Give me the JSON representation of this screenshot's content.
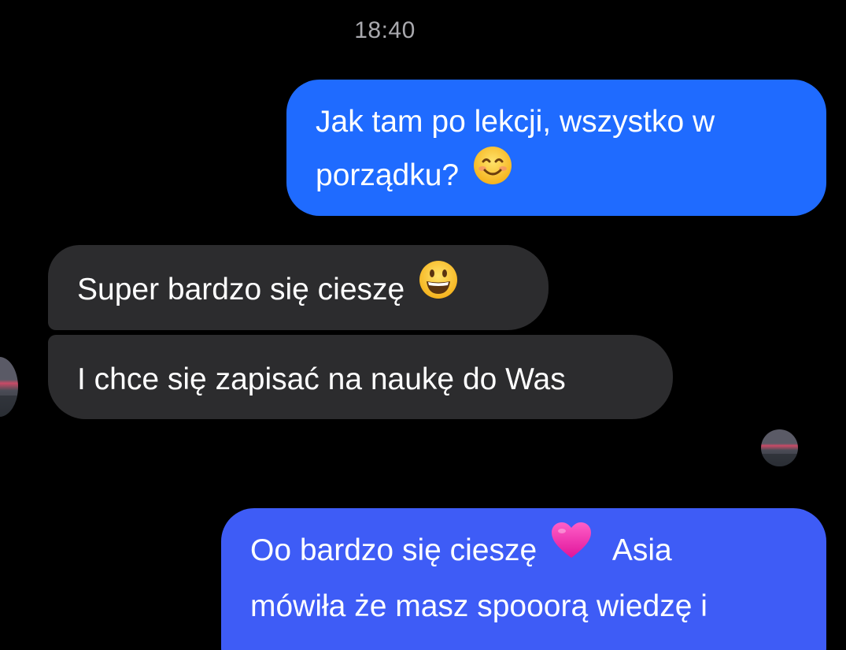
{
  "chat": {
    "timestamp": "18:40",
    "messages": [
      {
        "direction": "outgoing",
        "lines": [
          "Jak tam po lekcji, wszystko w",
          "porządku?"
        ],
        "emoji": "smiling-face-with-smiling-eyes"
      },
      {
        "direction": "incoming",
        "text": "Super bardzo się cieszę",
        "emoji": "grinning-face-with-big-eyes"
      },
      {
        "direction": "incoming",
        "text": "I chce się zapisać na naukę do Was"
      },
      {
        "direction": "outgoing",
        "lines": [
          "Oo bardzo się cieszę",
          "Asia",
          "mówiła że masz spooorą wiedzę i"
        ],
        "emoji": "pink-heart"
      }
    ]
  },
  "colors": {
    "background": "#000000",
    "outgoing_bubble_top": "#1f6bff",
    "outgoing_bubble_bottom": "#3e5cf6",
    "incoming_bubble": "#2c2c2e",
    "timestamp_text": "#a9a9ae",
    "message_text": "#ffffff"
  }
}
